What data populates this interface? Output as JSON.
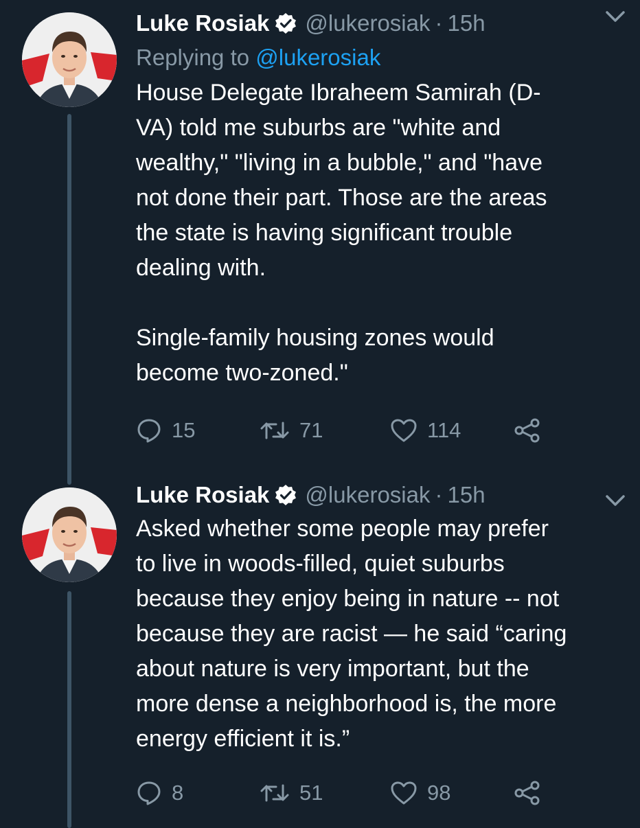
{
  "tweets": [
    {
      "name": "Luke Rosiak",
      "handle": "@lukerosiak",
      "separator": "·",
      "time": "15h",
      "replying_prefix": "Replying to ",
      "replying_to": "@lukerosiak",
      "text": "House Delegate Ibraheem Samirah (D-\nVA) told me suburbs are \"white and\nwealthy,\" \"living in a bubble,\" and \"have\nnot done their part. Those are the areas\nthe state is having significant trouble\ndealing with.\n\nSingle-family housing zones would\nbecome two-zoned.\"",
      "replies": "15",
      "retweets": "71",
      "likes": "114"
    },
    {
      "name": "Luke Rosiak",
      "handle": "@lukerosiak",
      "separator": "·",
      "time": "15h",
      "text": "Asked whether some people may prefer\nto live in woods-filled, quiet suburbs\nbecause they enjoy being in nature -- not\nbecause they are racist — he said “caring\nabout nature is very important, but the\nmore dense a neighborhood is, the more\nenergy efficient it is.”",
      "replies": "8",
      "retweets": "51",
      "likes": "98"
    }
  ],
  "colors": {
    "background": "#15202b",
    "text": "#ffffff",
    "secondary": "#8899a6",
    "link": "#1da1f2",
    "thread_line": "#3d5466"
  },
  "icons": [
    "verified-badge-icon",
    "chevron-down-icon",
    "reply-icon",
    "retweet-icon",
    "like-icon",
    "share-icon"
  ]
}
